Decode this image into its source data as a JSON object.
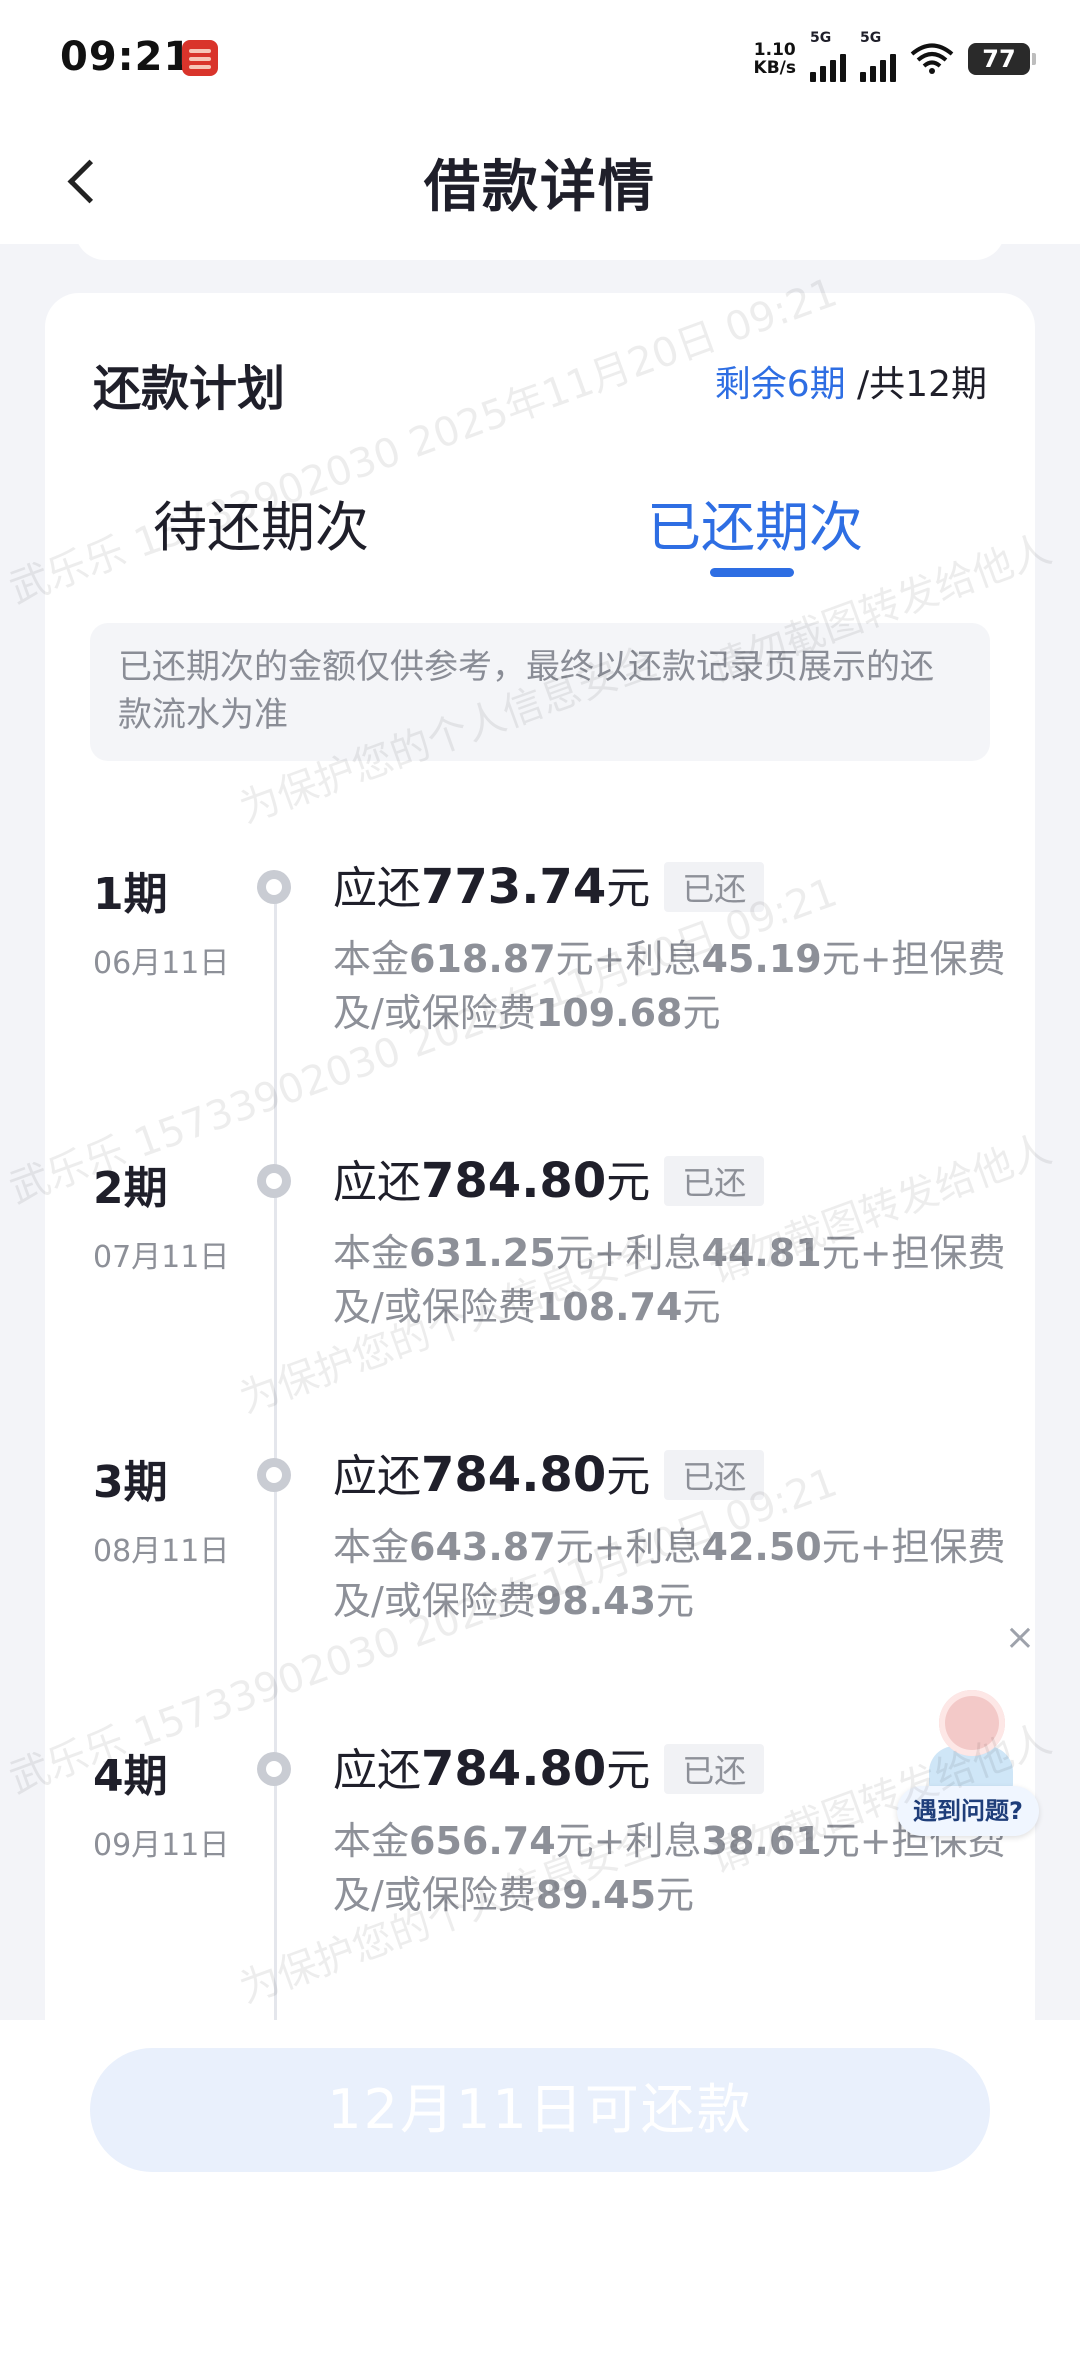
{
  "status_bar": {
    "time": "09:21",
    "net_speed_value": "1.10",
    "net_speed_unit": "KB/s",
    "sim1_label": "5G",
    "sim2_label": "5G",
    "battery": "77"
  },
  "header": {
    "title": "借款详情"
  },
  "plan": {
    "title": "还款计划",
    "remaining": "剩余6期",
    "total": "/共12期"
  },
  "tabs": {
    "pending": "待还期次",
    "paid": "已还期次",
    "active": "paid"
  },
  "notice": "已还期次的金额仅供参考，最终以还款记录页展示的还款流水为准",
  "periods": [
    {
      "num": "1期",
      "date": "06月11日",
      "due_label": "应还",
      "amount": "773.74",
      "unit": "元",
      "status": "已还",
      "principal_label": "本金",
      "principal": "618.87",
      "interest_label": "元+利息",
      "interest": "45.19",
      "fee_label": "元+担保费及/或保险费",
      "fee": "109.68",
      "fee_unit": "元"
    },
    {
      "num": "2期",
      "date": "07月11日",
      "due_label": "应还",
      "amount": "784.80",
      "unit": "元",
      "status": "已还",
      "principal_label": "本金",
      "principal": "631.25",
      "interest_label": "元+利息",
      "interest": "44.81",
      "fee_label": "元+担保费及/或保险费",
      "fee": "108.74",
      "fee_unit": "元"
    },
    {
      "num": "3期",
      "date": "08月11日",
      "due_label": "应还",
      "amount": "784.80",
      "unit": "元",
      "status": "已还",
      "principal_label": "本金",
      "principal": "643.87",
      "interest_label": "元+利息",
      "interest": "42.50",
      "fee_label": "元+担保费及/或保险费",
      "fee": "98.43",
      "fee_unit": "元"
    },
    {
      "num": "4期",
      "date": "09月11日",
      "due_label": "应还",
      "amount": "784.80",
      "unit": "元",
      "status": "已还",
      "principal_label": "本金",
      "principal": "656.74",
      "interest_label": "元+利息",
      "interest": "38.61",
      "fee_label": "元+担保费及/或保险费",
      "fee": "89.45",
      "fee_unit": "元"
    }
  ],
  "repay_button": "12月11日可还款",
  "help": {
    "label": "遇到问题?",
    "close": "×"
  },
  "watermark": {
    "line_id": "武乐乐 15733902030 2025年11月20日 09:21",
    "line_warn": "请勿截图转发给他人",
    "line_protect": "为保护您的个人信息安全"
  }
}
